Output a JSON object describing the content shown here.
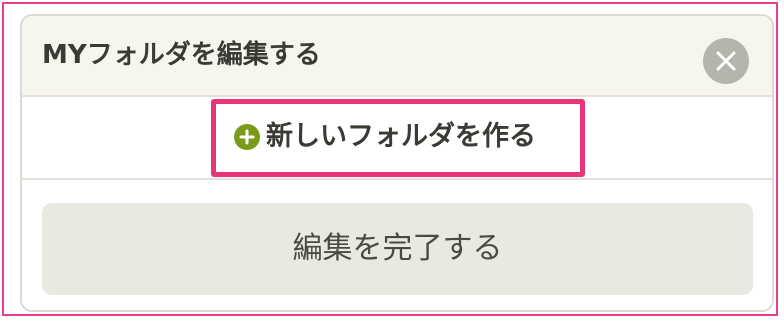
{
  "dialog": {
    "title": "MYフォルダを編集する",
    "close_icon": "close-icon"
  },
  "new_folder": {
    "label": "新しいフォルダを作る",
    "icon": "plus-circle-icon",
    "icon_color": "#7a9a1a"
  },
  "done_button": {
    "label": "編集を完了する"
  },
  "colors": {
    "highlight": "#e8357a",
    "header_bg": "#f6f5ee",
    "button_bg": "#e9e8e1"
  }
}
